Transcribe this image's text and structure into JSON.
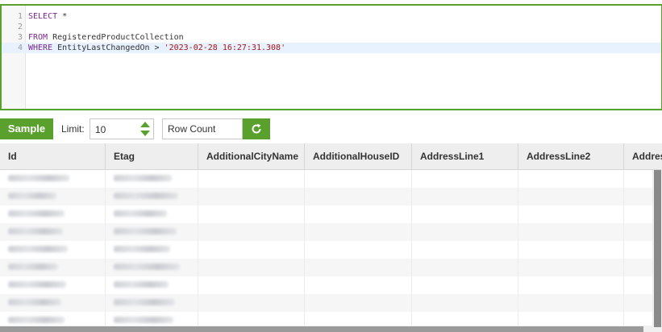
{
  "editor": {
    "lines": [
      {
        "num": "1",
        "parts": [
          {
            "cls": "kw",
            "text": "SELECT "
          },
          {
            "cls": "id",
            "text": "*"
          }
        ]
      },
      {
        "num": "2",
        "parts": []
      },
      {
        "num": "3",
        "parts": [
          {
            "cls": "kw",
            "text": "FROM "
          },
          {
            "cls": "id",
            "text": "RegisteredProductCollection"
          }
        ]
      },
      {
        "num": "4",
        "parts": [
          {
            "cls": "kw",
            "text": "WHERE "
          },
          {
            "cls": "id",
            "text": "EntityLastChangedOn > "
          },
          {
            "cls": "str",
            "text": "'2023-02-28 16:27:31.308'"
          }
        ]
      }
    ],
    "active_line": 4
  },
  "toolbar": {
    "sample_label": "Sample",
    "limit_label": "Limit:",
    "limit_value": "10",
    "row_count_label": "Row Count",
    "refresh_icon": "refresh-icon"
  },
  "grid": {
    "columns": [
      "Id",
      "Etag",
      "AdditionalCityName",
      "AdditionalHouseID",
      "AddressLine1",
      "AddressLine2",
      "Addres"
    ],
    "row_count": 9,
    "blurred_columns": [
      0,
      1
    ]
  },
  "colors": {
    "accent": "#5aa02c",
    "header_bg": "#eeeeee",
    "active_line_bg": "#e8f2fe"
  }
}
